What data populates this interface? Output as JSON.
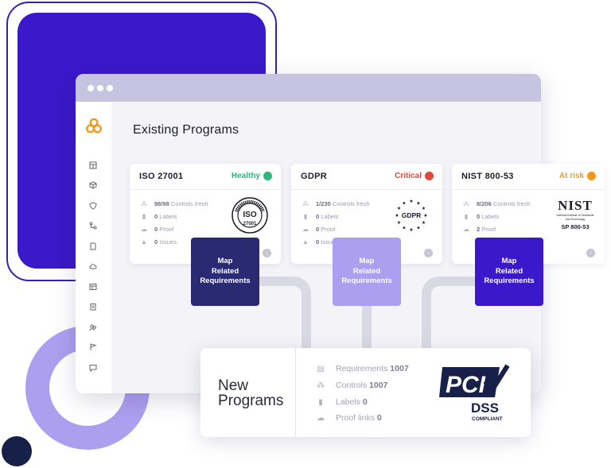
{
  "header": {
    "title": "Existing Programs"
  },
  "colors": {
    "accent": "#3b18c9",
    "healthy": "#2cb87a",
    "critical": "#e0483a",
    "at_risk": "#f39a1e"
  },
  "programs": [
    {
      "name": "ISO 27001",
      "status": "Healthy",
      "controls": {
        "value": "98/98",
        "label": "Controls fresh"
      },
      "labels": {
        "value": "0",
        "label": "Labels"
      },
      "proof": {
        "value": "0",
        "label": "Proof"
      },
      "issues": {
        "value": "0",
        "label": "Issues"
      },
      "logo": {
        "ring_text": "ISO 27001 INFORMATION SECURITY",
        "mark": "ISO",
        "number": "27001"
      }
    },
    {
      "name": "GDPR",
      "status": "Critical",
      "controls": {
        "value": "1/230",
        "label": "Controls fresh"
      },
      "labels": {
        "value": "0",
        "label": "Labels"
      },
      "proof": {
        "value": "0",
        "label": "Proof"
      },
      "issues": {
        "value": "0",
        "label": "Issues"
      },
      "logo": {
        "mark": "GDPR"
      }
    },
    {
      "name": "NIST 800-53",
      "status": "At risk",
      "controls": {
        "value": "8/206",
        "label": "Controls fresh"
      },
      "labels": {
        "value": "0",
        "label": "Labels"
      },
      "proof": {
        "value": "2",
        "label": "Proof"
      },
      "logo": {
        "mark": "NIST",
        "sub": "National Institute of Standards and Technology",
        "code": "SP 800-53"
      }
    }
  ],
  "map_buttons": [
    {
      "label": "Map Related Requirements",
      "color": "#2a2a72"
    },
    {
      "label": "Map Related Requirements",
      "color": "#ad9ff0"
    },
    {
      "label": "Map Related Requirements",
      "color": "#3b18c9"
    }
  ],
  "new_programs": {
    "title_line1": "New",
    "title_line2": "Programs",
    "stats": [
      {
        "label": "Requirements",
        "value": "1007",
        "icon": "clipboard-icon"
      },
      {
        "label": "Controls",
        "value": "1007",
        "icon": "controls-icon"
      },
      {
        "label": "Labels",
        "value": "0",
        "icon": "bookmark-icon"
      },
      {
        "label": "Proof links",
        "value": "0",
        "icon": "cloud-icon"
      }
    ],
    "logo": {
      "mark": "PCI",
      "sub": "DSS",
      "caption": "COMPLIANT"
    }
  },
  "sidebar": {
    "icons": [
      "dashboard-icon",
      "cube-icon",
      "shield-icon",
      "nodes-icon",
      "document-icon",
      "cloud-icon",
      "table-icon",
      "clipboard-icon",
      "team-icon",
      "flag-icon",
      "chat-icon"
    ]
  }
}
